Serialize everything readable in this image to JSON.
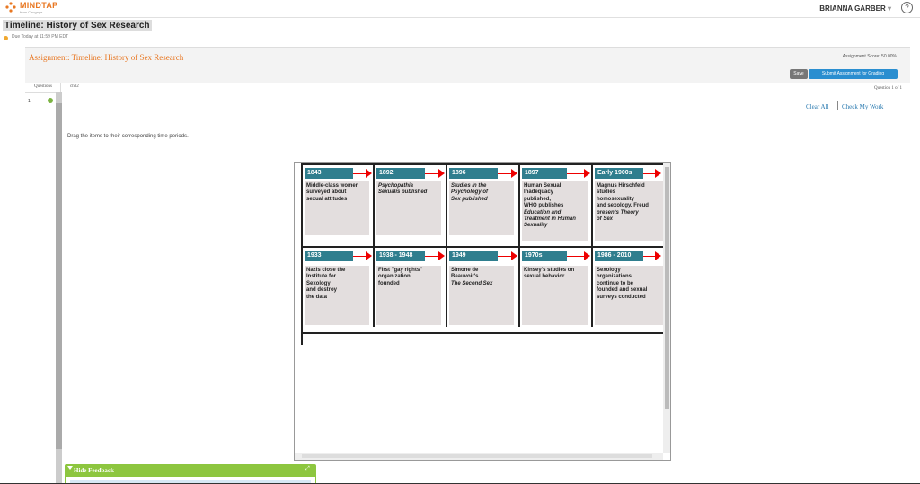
{
  "header": {
    "brand": "MINDTAP",
    "brand_sub": "from Cengage",
    "user": "BRIANNA GARBER",
    "user_caret": "▾",
    "help": "?"
  },
  "activity": {
    "title": "Timeline: History of Sex Research",
    "due": "Due Today at 11:59 PM EDT"
  },
  "assignment": {
    "title": "Assignment: Timeline: History of Sex Research",
    "score": "Assignment Score: 50.00%",
    "save_label": "Save",
    "submit_label": "Submit Assignment for Grading"
  },
  "questions": {
    "header": "Questions",
    "chapter": "ch02",
    "count": "Question 1 of 1",
    "items": [
      {
        "num": "1."
      }
    ]
  },
  "actions": {
    "clear_all": "Clear All",
    "check_work": "Check My Work"
  },
  "instructions": "Drag the items to their corresponding time periods.",
  "timeline": {
    "row1": [
      {
        "period": "1843",
        "lines": [
          "Middle-class women",
          "surveyed about",
          "sexual attitudes"
        ]
      },
      {
        "period": "1892",
        "lines": [
          "Psychopathia",
          "Sexualis published"
        ]
      },
      {
        "period": "1896",
        "lines": [
          "Studies in the",
          "Psychology of",
          "Sex published"
        ]
      },
      {
        "period": "1897",
        "lines": [
          "Human Sexual",
          "Inadequacy",
          "published,",
          "WHO publishes",
          "Education and",
          "Treatment in Human",
          "Sexuality"
        ]
      },
      {
        "period": "Early 1900s",
        "lines": [
          "Magnus Hirschfeld",
          "studies",
          "homosexuality",
          "and sexology, Freud",
          "presents Theory",
          "of Sex"
        ]
      }
    ],
    "row2": [
      {
        "period": "1933",
        "lines": [
          "Nazis close the",
          "Institute for",
          "Sexology",
          "and destroy",
          "the data"
        ]
      },
      {
        "period": "1938 - 1948",
        "lines": [
          "First \"gay rights\"",
          "organization",
          "founded"
        ]
      },
      {
        "period": "1949",
        "lines": [
          "Simone de",
          "Beauvoir's",
          "The Second Sex"
        ]
      },
      {
        "period": "1970s",
        "lines": [
          "Kinsey's studies on",
          "sexual behavior"
        ]
      },
      {
        "period": "1986 - 2010",
        "lines": [
          "Sexology",
          "organizations",
          "continue to be",
          "founded and sexual",
          "surveys conducted"
        ]
      }
    ]
  },
  "feedback": {
    "label": "Hide Feedback",
    "expand": "⤢"
  }
}
